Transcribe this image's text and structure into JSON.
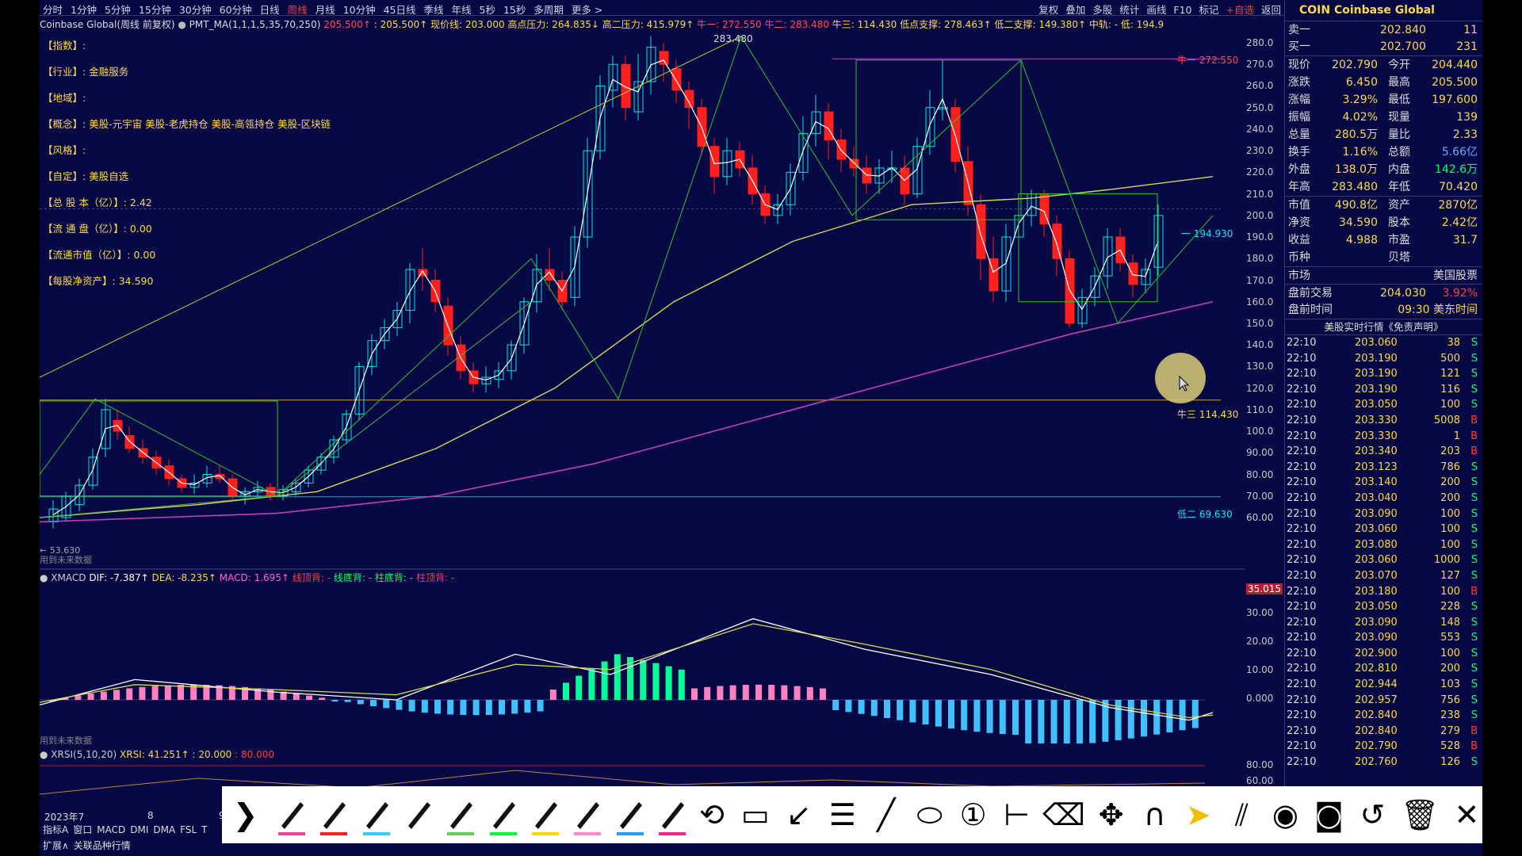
{
  "period_tabs": [
    "分时",
    "1分钟",
    "5分钟",
    "15分钟",
    "30分钟",
    "60分钟",
    "日线",
    "周线",
    "月线",
    "10分钟",
    "45日线",
    "季线",
    "年线",
    "5秒",
    "15秒",
    "多周期",
    "更多 >"
  ],
  "period_active": "周线",
  "tool_tabs": [
    "复权",
    "叠加",
    "多股",
    "统计",
    "画线",
    "F10",
    "标记",
    "+自选",
    "返回"
  ],
  "info_line": {
    "name": "Coinbase Global(周线 前复权)",
    "indicator": "PMT_MA(1,1,1,5,35,70,250)",
    "v1": "205.500↑",
    "v2": ": 205.500↑",
    "cur": "现价线: 203.000",
    "hp": "高点压力: 264.835↓",
    "p2": "高二压力: 415.979↑",
    "n1": "牛一: 272.550",
    "n2": "牛二: 283.480",
    "n3": "牛三: 114.430",
    "lp": "低点支撑: 278.463↑",
    "l2": "低二支撑: 149.380↑",
    "mid": "中轨: -",
    "low": "低: 194.9"
  },
  "fundamentals": [
    {
      "k": "【指数】",
      "v": ":"
    },
    {
      "k": "【行业】",
      "v": ": 金融服务"
    },
    {
      "k": "【地域】",
      "v": ":"
    },
    {
      "k": "【概念】",
      "v": ": 美股-元宇宙 美股-老虎持仓 美股-高瓴持仓 美股-区块链"
    },
    {
      "k": "【风格】",
      "v": ":"
    },
    {
      "k": "【自定】",
      "v": ": 美股自选"
    },
    {
      "k": "【总 股 本（亿）】",
      "v": ": 2.42"
    },
    {
      "k": "【流 通 盘（亿）】",
      "v": ": 0.00"
    },
    {
      "k": "【流通市值（亿）】",
      "v": ": 0.00"
    },
    {
      "k": "【每股净资产】",
      "v": ": 34.590"
    }
  ],
  "price_axis": [
    "280.0",
    "270.0",
    "260.0",
    "250.0",
    "240.0",
    "230.0",
    "220.0",
    "210.0",
    "200.0",
    "190.0",
    "180.0",
    "170.0",
    "160.0",
    "150.0",
    "140.0",
    "130.0",
    "120.0",
    "110.0",
    "100.0",
    "90.00",
    "80.00",
    "70.00",
    "60.00"
  ],
  "chart_labels": {
    "peak": "283.480",
    "niu1": "牛一 272.550",
    "niu3": "牛三 114.430",
    "di2": "低二 69.630",
    "cur": "一 194.930",
    "low": "← 53.630",
    "future1": "用到未来数据",
    "future2": "用到未来数据"
  },
  "macd": {
    "title": "XMACD",
    "dif": "DIF: -7.387↑",
    "dea": "DEA: -8.235↑",
    "macd": "MACD: 1.695↑",
    "t1": "线顶背: -",
    "t2": "线底背: -",
    "t3": "柱底背: -",
    "t4": "柱顶背: -",
    "axis": [
      "35.015",
      "30.00",
      "20.00",
      "10.00",
      "0.000"
    ]
  },
  "xrsi": {
    "title": "XRSI(5,10,20)",
    "v": "XRSI: 41.251↑",
    "a": ": 20.000",
    "b": ": 80.000",
    "axis": [
      "80.00",
      "60.00"
    ]
  },
  "time_axis": [
    "2023年7",
    "8",
    "9"
  ],
  "bottom_tabs": [
    "指标A",
    "窗口",
    "MACD",
    "DMI",
    "DMA",
    "FSL",
    "T"
  ],
  "bottom_tabs2": [
    "扩展∧",
    "关联品种行情"
  ],
  "quote": {
    "title": "COIN Coinbase Global",
    "sell1": {
      "l": "卖一",
      "p": "202.840",
      "v": "11"
    },
    "buy1": {
      "l": "买一",
      "p": "202.700",
      "v": "231"
    },
    "rows": [
      [
        "现价",
        "202.790",
        "今开",
        "204.440"
      ],
      [
        "涨跌",
        "6.450",
        "最高",
        "205.500"
      ],
      [
        "涨幅",
        "3.29%",
        "最低",
        "197.600"
      ],
      [
        "振幅",
        "4.02%",
        "现量",
        "139"
      ],
      [
        "总量",
        "280.5万",
        "量比",
        "2.33"
      ],
      [
        "换手",
        "1.16%",
        "总额",
        "5.66亿"
      ],
      [
        "外盘",
        "138.0万",
        "内盘",
        "142.6万"
      ],
      [
        "年高",
        "283.480",
        "年低",
        "70.420"
      ]
    ],
    "rows2": [
      [
        "市值",
        "490.8亿",
        "资产",
        "2870亿"
      ],
      [
        "净资",
        "34.590",
        "股本",
        "2.42亿"
      ],
      [
        "收益",
        "4.988",
        "市盈",
        "31.7"
      ],
      [
        "币种",
        "",
        "贝塔",
        ""
      ]
    ],
    "market_l": "市场",
    "market_v": "美国股票",
    "pre_l": "盘前交易",
    "pre_p": "204.030",
    "pre_pct": "3.92%",
    "pt_l": "盘前时间",
    "pt_v": "09:30 美东时间",
    "notice": "美股实时行情《免责声明》",
    "ticks": [
      [
        "22:10",
        "203.060",
        "38",
        "S"
      ],
      [
        "22:10",
        "203.190",
        "500",
        "S"
      ],
      [
        "22:10",
        "203.190",
        "121",
        "S"
      ],
      [
        "22:10",
        "203.190",
        "116",
        "S"
      ],
      [
        "22:10",
        "203.050",
        "100",
        "S"
      ],
      [
        "22:10",
        "203.330",
        "5008",
        "B"
      ],
      [
        "22:10",
        "203.330",
        "1",
        "B"
      ],
      [
        "22:10",
        "203.340",
        "203",
        "B"
      ],
      [
        "22:10",
        "203.123",
        "786",
        "S"
      ],
      [
        "22:10",
        "203.140",
        "200",
        "S"
      ],
      [
        "22:10",
        "203.040",
        "200",
        "S"
      ],
      [
        "22:10",
        "203.090",
        "100",
        "S"
      ],
      [
        "22:10",
        "203.060",
        "100",
        "S"
      ],
      [
        "22:10",
        "203.080",
        "100",
        "S"
      ],
      [
        "22:10",
        "203.060",
        "1000",
        "S"
      ],
      [
        "22:10",
        "203.070",
        "127",
        "S"
      ],
      [
        "22:10",
        "203.180",
        "100",
        "B"
      ],
      [
        "22:10",
        "203.050",
        "228",
        "S"
      ],
      [
        "22:10",
        "203.090",
        "148",
        "S"
      ],
      [
        "22:10",
        "203.090",
        "553",
        "S"
      ],
      [
        "22:10",
        "202.900",
        "100",
        "S"
      ],
      [
        "22:10",
        "202.810",
        "200",
        "S"
      ],
      [
        "22:10",
        "202.944",
        "103",
        "S"
      ],
      [
        "22:10",
        "202.957",
        "756",
        "S"
      ],
      [
        "22:10",
        "202.840",
        "238",
        "S"
      ],
      [
        "22:10",
        "202.840",
        "279",
        "B"
      ],
      [
        "22:10",
        "202.790",
        "528",
        "B"
      ],
      [
        "22:10",
        "202.760",
        "126",
        "S"
      ]
    ]
  },
  "drawbar_tools": [
    "expand-arrow",
    "pen-pink",
    "pen-red",
    "pen-cyan",
    "pen-white",
    "pen-green",
    "pen-bright-green",
    "pen-yellow",
    "pen-pink-light",
    "pen-blue",
    "pen-magenta",
    "lasso",
    "rectangle",
    "arrow-line",
    "text-lines",
    "line",
    "ellipse",
    "number-marker",
    "hanger",
    "eraser",
    "move",
    "magnet",
    "pointer",
    "hatch",
    "eye",
    "camera",
    "undo",
    "trash",
    "close"
  ]
}
